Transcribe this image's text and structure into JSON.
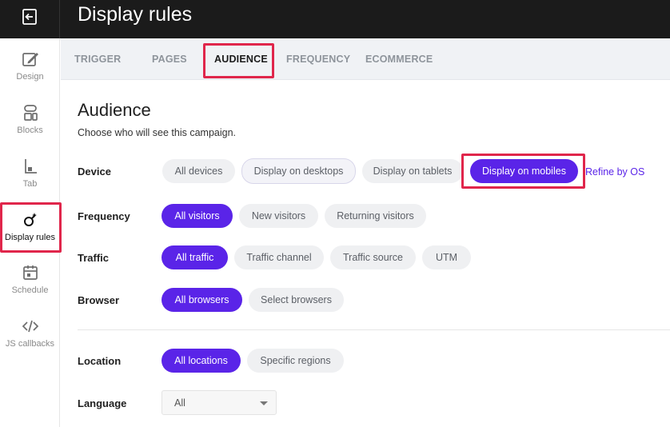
{
  "header": {
    "title": "Display rules"
  },
  "sidebar": {
    "items": [
      {
        "label": "Design",
        "icon": "design-icon"
      },
      {
        "label": "Blocks",
        "icon": "blocks-icon"
      },
      {
        "label": "Tab",
        "icon": "tab-icon"
      },
      {
        "label": "Display rules",
        "icon": "display-rules-icon",
        "active": true
      },
      {
        "label": "Schedule",
        "icon": "schedule-icon"
      },
      {
        "label": "JS callbacks",
        "icon": "code-icon"
      }
    ]
  },
  "tabs": [
    {
      "label": "TRIGGER"
    },
    {
      "label": "PAGES"
    },
    {
      "label": "AUDIENCE",
      "active": true
    },
    {
      "label": "FREQUENCY"
    },
    {
      "label": "ECOMMERCE"
    }
  ],
  "section": {
    "title": "Audience",
    "subtitle": "Choose who will see this campaign."
  },
  "device": {
    "label": "Device",
    "options": [
      "All devices",
      "Display on desktops",
      "Display on tablets",
      "Display on mobiles"
    ],
    "refine_link": "Refine by OS"
  },
  "frequency": {
    "label": "Frequency",
    "options": [
      "All visitors",
      "New visitors",
      "Returning visitors"
    ]
  },
  "traffic": {
    "label": "Traffic",
    "options": [
      "All traffic",
      "Traffic channel",
      "Traffic source",
      "UTM"
    ]
  },
  "browser": {
    "label": "Browser",
    "options": [
      "All browsers",
      "Select browsers"
    ]
  },
  "location": {
    "label": "Location",
    "options": [
      "All locations",
      "Specific regions"
    ]
  },
  "language": {
    "label": "Language",
    "value": "All"
  },
  "colors": {
    "accent": "#5a24e8",
    "highlight": "#e0264b",
    "topbar": "#1b1b1b"
  }
}
